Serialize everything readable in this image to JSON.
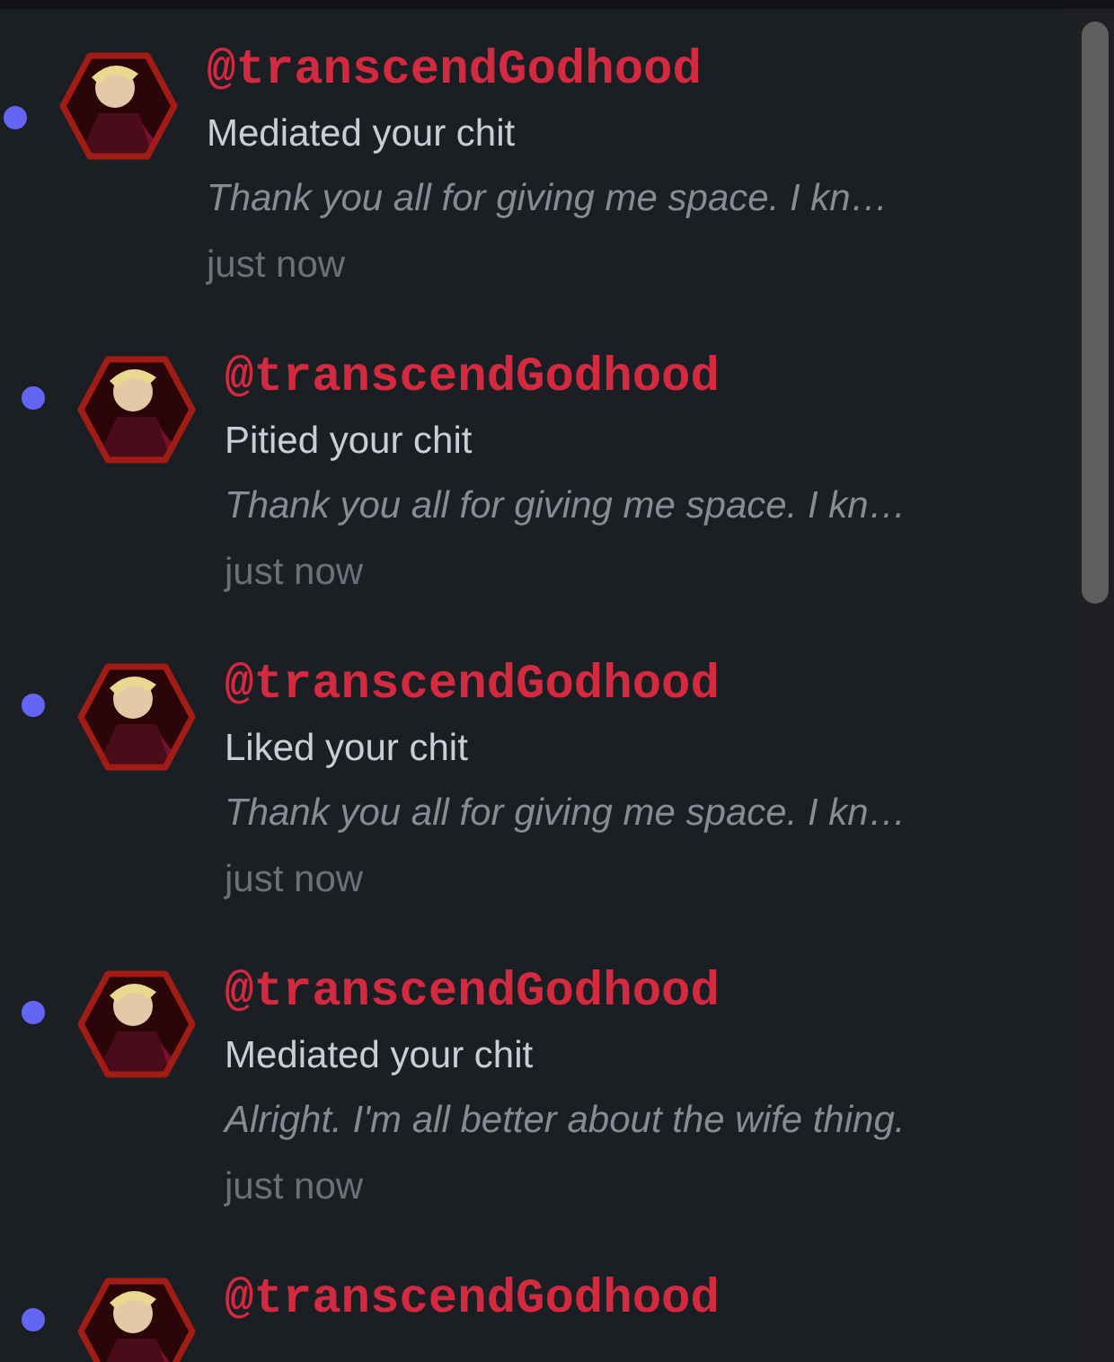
{
  "notifications": [
    {
      "unread": true,
      "username": "@transcendGodhood",
      "action": "Mediated your chit",
      "preview": "Thank you all for giving me space. I kn…",
      "time": "just now"
    },
    {
      "unread": true,
      "username": "@transcendGodhood",
      "action": "Pitied your chit",
      "preview": "Thank you all for giving me space. I kn…",
      "time": "just now"
    },
    {
      "unread": true,
      "username": "@transcendGodhood",
      "action": "Liked your chit",
      "preview": "Thank you all for giving me space. I kn…",
      "time": "just now"
    },
    {
      "unread": true,
      "username": "@transcendGodhood",
      "action": "Mediated your chit",
      "preview": "Alright. I'm all better about the wife thing.",
      "time": "just now"
    },
    {
      "unread": true,
      "username": "@transcendGodhood"
    }
  ]
}
